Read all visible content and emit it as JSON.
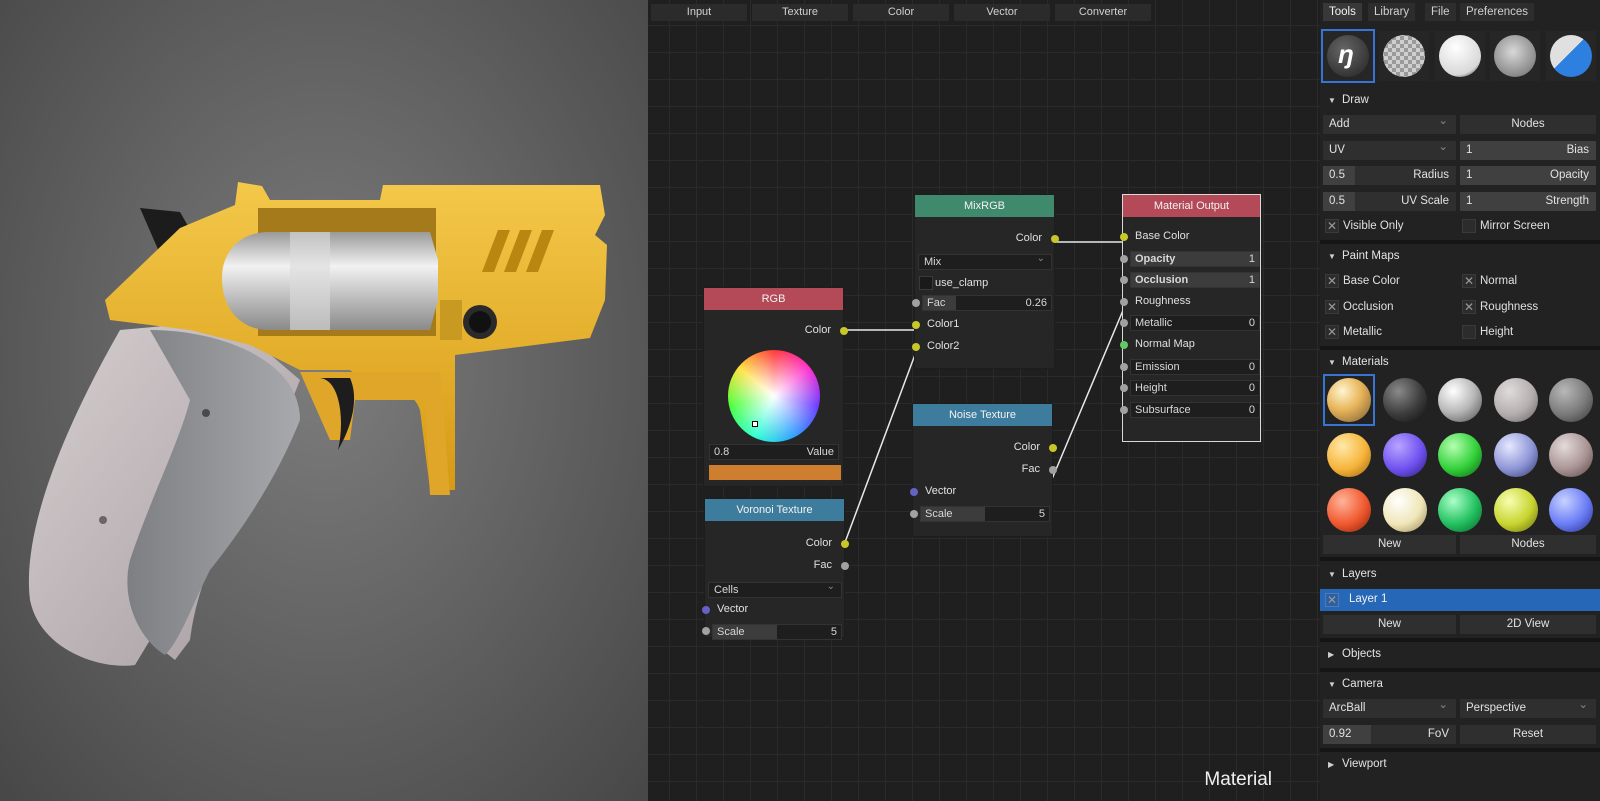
{
  "node_menu": [
    "Input",
    "Texture",
    "Color",
    "Vector",
    "Converter"
  ],
  "canvas_label": "Material",
  "nodes": {
    "rgb": {
      "title": "RGB",
      "out": "Color",
      "value": "0.8",
      "value_label": "Value",
      "color_swatch": "#cd7f2f",
      "header_color": "#b44a58"
    },
    "voronoi": {
      "title": "Voronoi Texture",
      "out_color": "Color",
      "out_fac": "Fac",
      "mode": "Cells",
      "in_vector": "Vector",
      "scale_label": "Scale",
      "scale": "5",
      "header_color": "#3e7c9e"
    },
    "mixrgb": {
      "title": "MixRGB",
      "out": "Color",
      "blend": "Mix",
      "clamp_label": "use_clamp",
      "fac_label": "Fac",
      "fac": "0.26",
      "fac_fraction": 0.26,
      "in1": "Color1",
      "in2": "Color2",
      "header_color": "#3f8a6c"
    },
    "noise": {
      "title": "Noise Texture",
      "out_color": "Color",
      "out_fac": "Fac",
      "in_vector": "Vector",
      "scale_label": "Scale",
      "scale": "5",
      "header_color": "#3e7c9e"
    },
    "output": {
      "title": "Material Output",
      "header_color": "#b44a58",
      "inputs": [
        {
          "label": "Base Color",
          "value": ""
        },
        {
          "label": "Opacity",
          "value": "1"
        },
        {
          "label": "Occlusion",
          "value": "1"
        },
        {
          "label": "Roughness",
          "value": ""
        },
        {
          "label": "Metallic",
          "value": "0"
        },
        {
          "label": "Normal Map",
          "value": ""
        },
        {
          "label": "Emission",
          "value": "0"
        },
        {
          "label": "Height",
          "value": "0"
        },
        {
          "label": "Subsurface",
          "value": "0"
        }
      ]
    }
  },
  "panel": {
    "tabs": [
      "Tools",
      "Library",
      "File",
      "Preferences"
    ],
    "draw": {
      "title": "Draw",
      "blend": "Add",
      "nodes_btn": "Nodes",
      "mapping": "UV",
      "bias": {
        "label": "Bias",
        "value": "1"
      },
      "radius": {
        "label": "Radius",
        "value": "0.5"
      },
      "opacity": {
        "label": "Opacity",
        "value": "1"
      },
      "uv_scale": {
        "label": "UV Scale",
        "value": "0.5"
      },
      "strength": {
        "label": "Strength",
        "value": "1"
      },
      "visible_only": "Visible Only",
      "mirror_screen": "Mirror Screen"
    },
    "paint_maps": {
      "title": "Paint Maps",
      "items": [
        {
          "label": "Base Color",
          "checked": true
        },
        {
          "label": "Normal",
          "checked": true
        },
        {
          "label": "Occlusion",
          "checked": true
        },
        {
          "label": "Roughness",
          "checked": true
        },
        {
          "label": "Metallic",
          "checked": true
        },
        {
          "label": "Height",
          "checked": false
        }
      ]
    },
    "materials": {
      "title": "Materials",
      "new_btn": "New",
      "nodes_btn": "Nodes"
    },
    "layers": {
      "title": "Layers",
      "layer_name": "Layer 1",
      "new_btn": "New",
      "view_btn": "2D View"
    },
    "objects": {
      "title": "Objects"
    },
    "camera": {
      "title": "Camera",
      "mode": "ArcBall",
      "projection": "Perspective",
      "fov_label": "FoV",
      "fov": "0.92",
      "reset_btn": "Reset"
    },
    "viewport": {
      "title": "Viewport"
    }
  },
  "colors": {
    "accent": "#3774d4",
    "socket_yellow": "#c7c729",
    "socket_gray": "#a1a1a1",
    "socket_blue": "#6363c7",
    "socket_green": "#63c763"
  }
}
